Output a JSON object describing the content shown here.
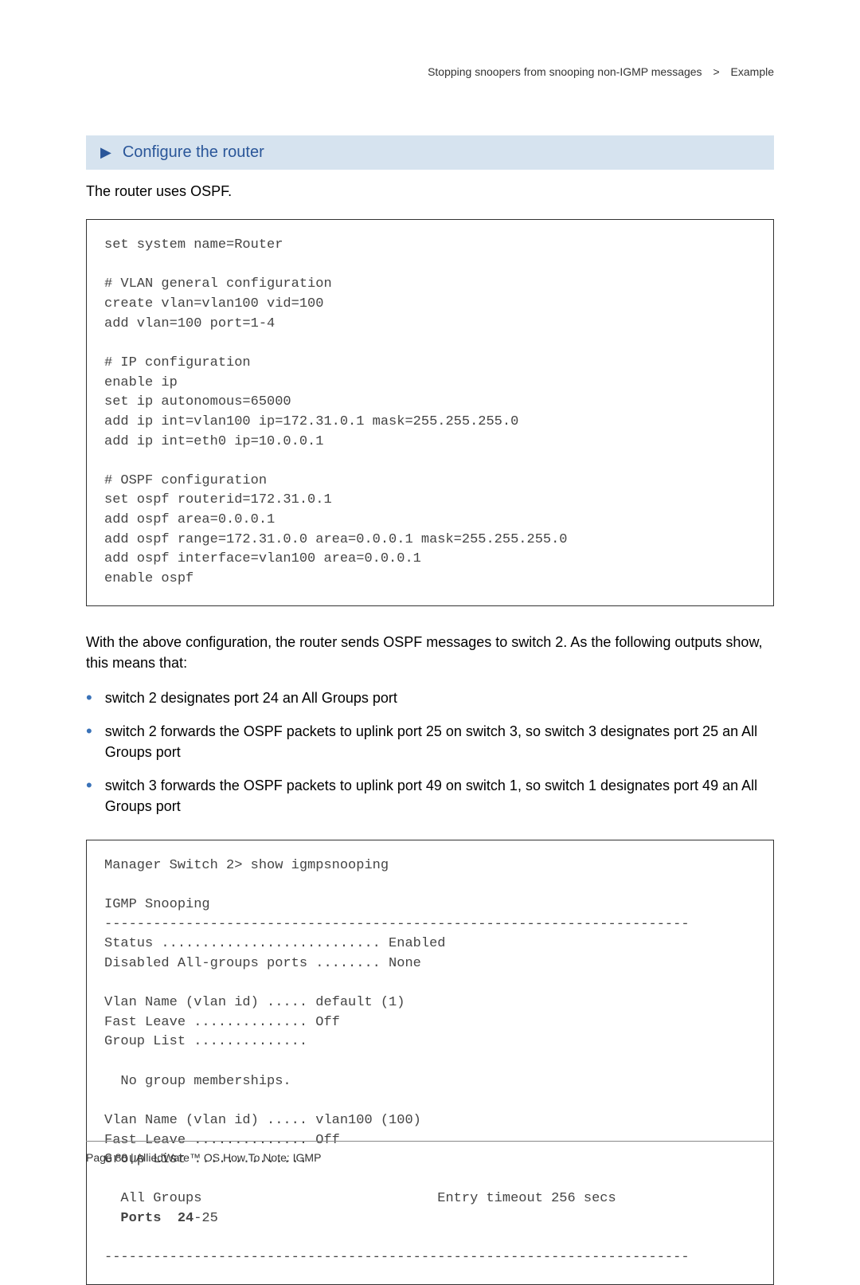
{
  "header": {
    "section": "Stopping snoopers from snooping non-IGMP messages",
    "separator": ">",
    "subsection": "Example"
  },
  "step": {
    "arrow": "▶",
    "label": "Configure the router"
  },
  "intro": "The router uses OSPF.",
  "code1": "set system name=Router\n\n# VLAN general configuration\ncreate vlan=vlan100 vid=100\nadd vlan=100 port=1-4\n\n# IP configuration\nenable ip\nset ip autonomous=65000\nadd ip int=vlan100 ip=172.31.0.1 mask=255.255.255.0\nadd ip int=eth0 ip=10.0.0.1\n\n# OSPF configuration\nset ospf routerid=172.31.0.1\nadd ospf area=0.0.0.1\nadd ospf range=172.31.0.0 area=0.0.0.1 mask=255.255.255.0\nadd ospf interface=vlan100 area=0.0.0.1\nenable ospf",
  "para2": "With the above configuration, the router sends OSPF messages to switch 2. As the following outputs show, this means that:",
  "bullets": [
    "switch 2 designates port 24 an All Groups port",
    "switch 2 forwards the OSPF packets to uplink port 25 on switch 3, so switch 3 designates port 25 an All Groups port",
    "switch 3 forwards the OSPF packets to uplink port 49 on switch 1, so switch 1 designates port 49 an All Groups port"
  ],
  "output": {
    "pre": "Manager Switch 2> show igmpsnooping\n\nIGMP Snooping\n------------------------------------------------------------------------\nStatus ........................... Enabled\nDisabled All-groups ports ........ None\n\nVlan Name (vlan id) ..... default (1)\nFast Leave .............. Off\nGroup List ..............\n\n  No group memberships.\n\nVlan Name (vlan id) ..... vlan100 (100)\nFast Leave .............. Off\nGroup List ..............\n\n  All Groups                             Entry timeout 256 secs\n  ",
    "bold_label": "Ports  24",
    "bold_rest": "-25",
    "post": "\n\n------------------------------------------------------------------------"
  },
  "footer": "Page 88 | AlliedWare™ OS How To Note: IGMP"
}
